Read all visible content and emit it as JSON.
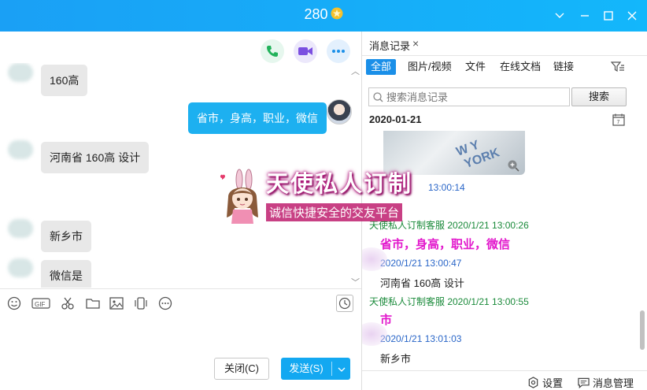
{
  "window": {
    "title": "280"
  },
  "left": {
    "messages": [
      {
        "dir": "in",
        "text": "160高"
      },
      {
        "dir": "out",
        "text": "省市，身高，职业，微信"
      },
      {
        "dir": "in",
        "text": "河南省  160高   设计"
      },
      {
        "dir": "in",
        "text": "新乡市"
      },
      {
        "dir": "in",
        "text": "微信是"
      }
    ],
    "buttons": {
      "close": "关闭(C)",
      "send": "发送(S)"
    }
  },
  "right": {
    "tab_label": "消息记录",
    "filters": [
      "全部",
      "图片/视频",
      "文件",
      "在线文档",
      "链接"
    ],
    "search_placeholder": "搜索消息记录",
    "search_button": "搜索",
    "date": "2020-01-21",
    "history": [
      {
        "kind": "meta",
        "text": "13:00:14"
      },
      {
        "kind": "meta-green",
        "text": "天使私人订制客服 2020/1/21 13:00:26"
      },
      {
        "kind": "big",
        "text": "省市，身高，职业，微信"
      },
      {
        "kind": "meta",
        "text": "2020/1/21 13:00:47"
      },
      {
        "kind": "text",
        "text": "河南省  160高   设计"
      },
      {
        "kind": "meta-green",
        "text": "天使私人订制客服 2020/1/21 13:00:55"
      },
      {
        "kind": "big",
        "text": "市"
      },
      {
        "kind": "meta",
        "text": "2020/1/21 13:01:03"
      },
      {
        "kind": "text",
        "text": "新乡市"
      }
    ],
    "footer": {
      "settings": "设置",
      "manage": "消息管理"
    }
  },
  "watermark": {
    "line1": "天使私人订制",
    "line2": "诚信快捷安全的交友平台"
  },
  "colors": {
    "accent": "#13a8f1",
    "titlebar": "#1aa0f5",
    "highlight": "#e218cc",
    "meta_green": "#1a8a3a"
  }
}
